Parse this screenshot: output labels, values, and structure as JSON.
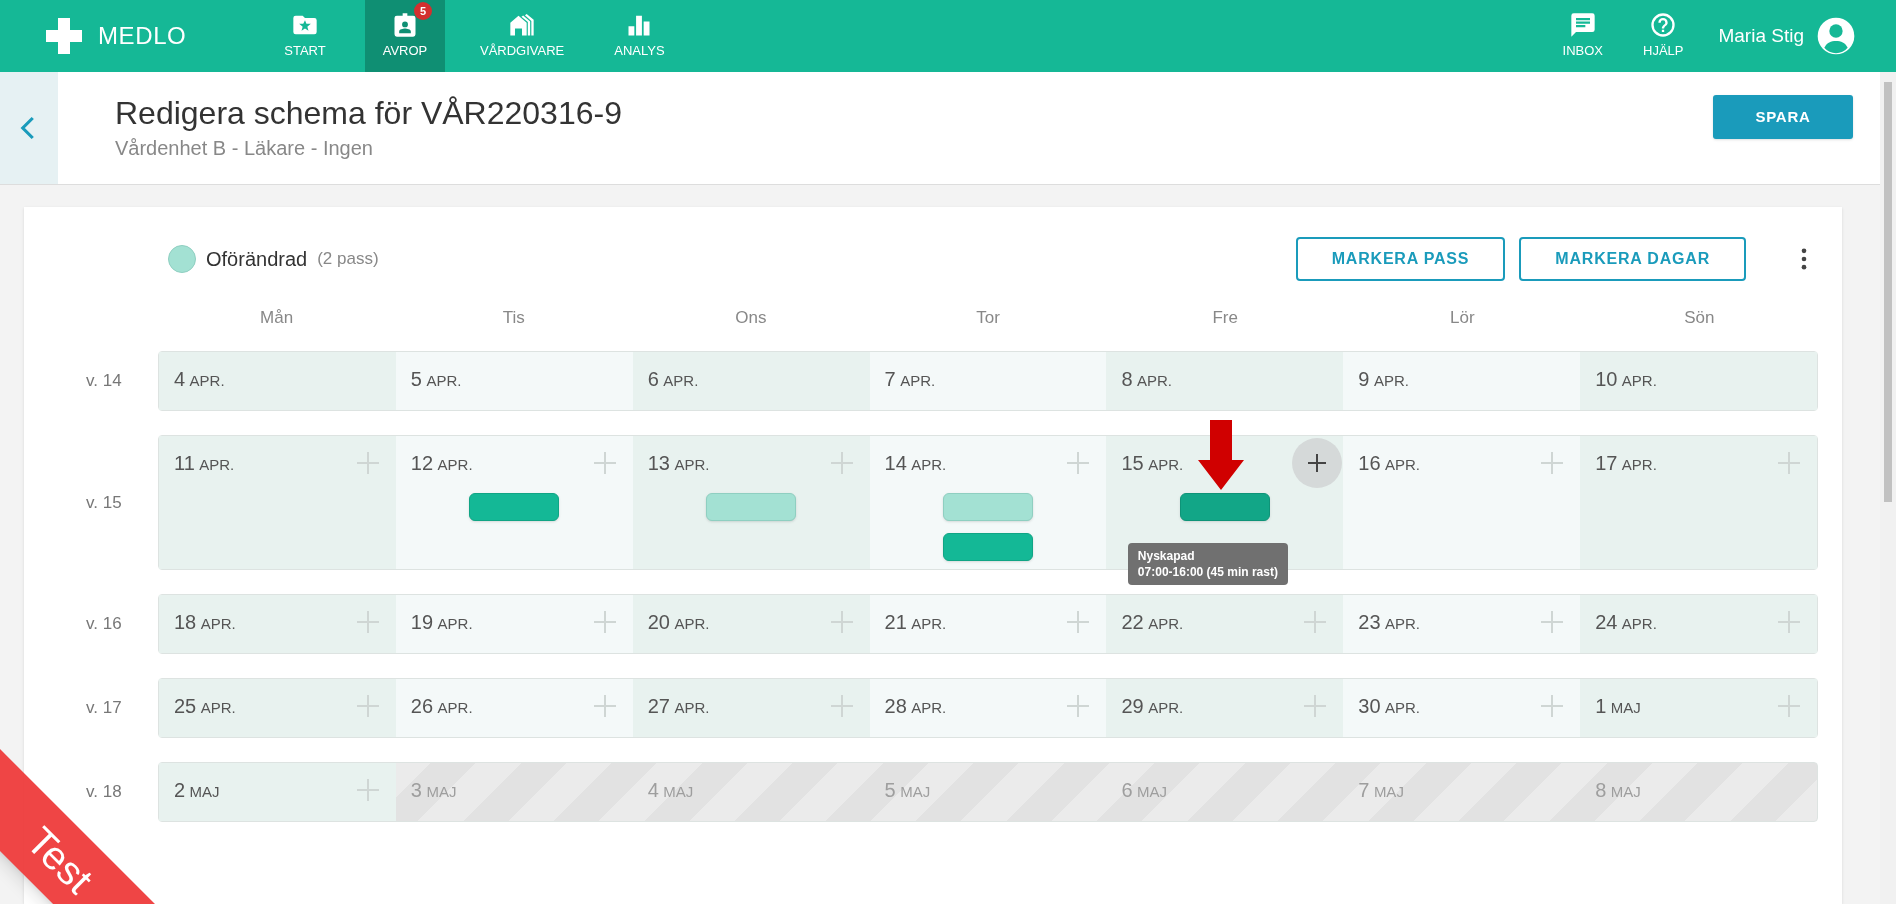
{
  "app": {
    "name": "MEDLO"
  },
  "nav": [
    {
      "label": "START",
      "kind": "folder",
      "selected": false
    },
    {
      "label": "AVROP",
      "kind": "badge",
      "selected": true,
      "badge": "5"
    },
    {
      "label": "VÅRDGIVARE",
      "kind": "building",
      "selected": false
    },
    {
      "label": "ANALYS",
      "kind": "chart",
      "selected": false
    }
  ],
  "nav_right": [
    {
      "label": "INBOX",
      "kind": "message"
    },
    {
      "label": "HJÄLP",
      "kind": "help"
    }
  ],
  "user": {
    "name": "Maria Stig"
  },
  "header": {
    "title": "Redigera schema för VÅR220316-9",
    "subtitle": "Vårdenhet B - Läkare - Ingen",
    "save": "SPARA"
  },
  "legend": [
    {
      "label": "Oförändrad",
      "count": "(2 pass)",
      "color": "#a3e1d3"
    }
  ],
  "actions": [
    "MARKERA PASS",
    "MARKERA DAGAR"
  ],
  "weekdays": [
    "Mån",
    "Tis",
    "Ons",
    "Tor",
    "Fre",
    "Lör",
    "Sön"
  ],
  "weeks": [
    {
      "label": "v. 14",
      "days": [
        {
          "day": "4",
          "month": "APR.",
          "kind": "plain"
        },
        {
          "day": "5",
          "month": "APR.",
          "kind": "plain"
        },
        {
          "day": "6",
          "month": "APR.",
          "kind": "plain"
        },
        {
          "day": "7",
          "month": "APR.",
          "kind": "plain"
        },
        {
          "day": "8",
          "month": "APR.",
          "kind": "plain"
        },
        {
          "day": "9",
          "month": "APR.",
          "kind": "plain"
        },
        {
          "day": "10",
          "month": "APR.",
          "kind": "plain"
        }
      ]
    },
    {
      "label": "v. 15",
      "days": [
        {
          "day": "11",
          "month": "APR.",
          "kind": "open",
          "add_hovered": false
        },
        {
          "day": "12",
          "month": "APR.",
          "kind": "open",
          "add_hovered": false,
          "shifts": [
            {
              "kind": "new",
              "hovered": false
            }
          ]
        },
        {
          "day": "13",
          "month": "APR.",
          "kind": "open",
          "add_hovered": false,
          "shifts": [
            {
              "kind": "unchanged",
              "hovered": false
            }
          ]
        },
        {
          "day": "14",
          "month": "APR.",
          "kind": "open",
          "add_hovered": false,
          "shifts": [
            {
              "kind": "unchanged",
              "hovered": false
            },
            {
              "kind": "new",
              "hovered": false
            }
          ]
        },
        {
          "day": "15",
          "month": "APR.",
          "kind": "open",
          "add_hovered": true,
          "marker": true,
          "shifts": [
            {
              "kind": "new",
              "hovered": true,
              "tooltip": {
                "title": "Nyskapad",
                "text": "07:00-16:00 (45 min rast)"
              }
            }
          ]
        },
        {
          "day": "16",
          "month": "APR.",
          "kind": "open",
          "add_hovered": false
        },
        {
          "day": "17",
          "month": "APR.",
          "kind": "open",
          "add_hovered": false
        }
      ]
    },
    {
      "label": "v. 16",
      "days": [
        {
          "day": "18",
          "month": "APR.",
          "kind": "open",
          "add_hovered": false
        },
        {
          "day": "19",
          "month": "APR.",
          "kind": "open",
          "add_hovered": false
        },
        {
          "day": "20",
          "month": "APR.",
          "kind": "open",
          "add_hovered": false
        },
        {
          "day": "21",
          "month": "APR.",
          "kind": "open",
          "add_hovered": false
        },
        {
          "day": "22",
          "month": "APR.",
          "kind": "open",
          "add_hovered": false
        },
        {
          "day": "23",
          "month": "APR.",
          "kind": "open",
          "add_hovered": false
        },
        {
          "day": "24",
          "month": "APR.",
          "kind": "open",
          "add_hovered": false
        }
      ]
    },
    {
      "label": "v. 17",
      "days": [
        {
          "day": "25",
          "month": "APR.",
          "kind": "open",
          "add_hovered": false
        },
        {
          "day": "26",
          "month": "APR.",
          "kind": "open",
          "add_hovered": false
        },
        {
          "day": "27",
          "month": "APR.",
          "kind": "open",
          "add_hovered": false
        },
        {
          "day": "28",
          "month": "APR.",
          "kind": "open",
          "add_hovered": false
        },
        {
          "day": "29",
          "month": "APR.",
          "kind": "open",
          "add_hovered": false
        },
        {
          "day": "30",
          "month": "APR.",
          "kind": "open",
          "add_hovered": false
        },
        {
          "day": "1",
          "month": "MAJ",
          "kind": "open",
          "add_hovered": false
        }
      ]
    },
    {
      "label": "v. 18",
      "days": [
        {
          "day": "2",
          "month": "MAJ",
          "kind": "open",
          "add_hovered": false
        },
        {
          "day": "3",
          "month": "MAJ",
          "kind": "disabled"
        },
        {
          "day": "4",
          "month": "MAJ",
          "kind": "disabled"
        },
        {
          "day": "5",
          "month": "MAJ",
          "kind": "disabled"
        },
        {
          "day": "6",
          "month": "MAJ",
          "kind": "disabled"
        },
        {
          "day": "7",
          "month": "MAJ",
          "kind": "disabled"
        },
        {
          "day": "8",
          "month": "MAJ",
          "kind": "disabled"
        }
      ]
    }
  ],
  "ribbon": {
    "label": "Test"
  }
}
